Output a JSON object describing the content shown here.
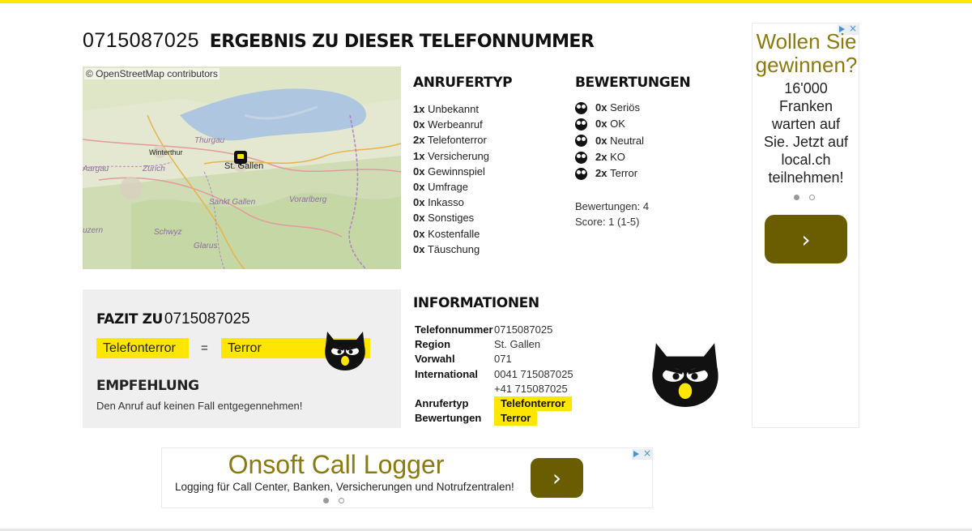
{
  "header": {
    "number": "0715087025",
    "title_suffix": "ERGEBNIS ZU DIESER TELEFONNUMMER"
  },
  "map": {
    "attribution": "© OpenStreetMap contributors",
    "center_city": "St. Gallen",
    "labels": [
      "Thurgau",
      "Winterthur",
      "Aargau",
      "Zürich",
      "Sankt Gallen",
      "Vorarlberg",
      "Schwyz",
      "Glarus",
      "uzern"
    ],
    "pin_icon": "map-marker-icon"
  },
  "anrufertyp": {
    "title": "ANRUFERTYP",
    "items": [
      {
        "count": "1x",
        "label": "Unbekannt"
      },
      {
        "count": "0x",
        "label": "Werbeanruf"
      },
      {
        "count": "2x",
        "label": "Telefonterror"
      },
      {
        "count": "1x",
        "label": "Versicherung"
      },
      {
        "count": "0x",
        "label": "Gewinnspiel"
      },
      {
        "count": "0x",
        "label": "Umfrage"
      },
      {
        "count": "0x",
        "label": "Inkasso"
      },
      {
        "count": "0x",
        "label": "Sonstiges"
      },
      {
        "count": "0x",
        "label": "Kostenfalle"
      },
      {
        "count": "0x",
        "label": "Täuschung"
      }
    ]
  },
  "bewertungen": {
    "title": "BEWERTUNGEN",
    "items": [
      {
        "count": "0x",
        "label": "Seriös",
        "icon": "owl-serioes-icon"
      },
      {
        "count": "0x",
        "label": "OK",
        "icon": "owl-ok-icon"
      },
      {
        "count": "0x",
        "label": "Neutral",
        "icon": "owl-neutral-icon"
      },
      {
        "count": "2x",
        "label": "KO",
        "icon": "owl-ko-icon"
      },
      {
        "count": "2x",
        "label": "Terror",
        "icon": "owl-terror-icon"
      }
    ],
    "total_text": "Bewertungen: 4",
    "score_text": "Score: 1 (1-5)"
  },
  "fazit": {
    "title_bold": "FAZIT ZU",
    "number": "0715087025",
    "type_tag": "Telefonterror",
    "equals": "=",
    "rating_tag": "Terror",
    "empfehlung_title": "EMPFEHLUNG",
    "empfehlung_text": "Den Anruf auf keinen Fall entgegennehmen!"
  },
  "informationen": {
    "title": "INFORMATIONEN",
    "rows": {
      "telefonnummer": {
        "key": "Telefonnummer",
        "value": "0715087025"
      },
      "region": {
        "key": "Region",
        "value": "St. Gallen"
      },
      "vorwahl": {
        "key": "Vorwahl",
        "value": "071"
      },
      "international": {
        "key": "International",
        "value1": "0041 715087025",
        "value2": "+41 715087025"
      },
      "anrufertyp": {
        "key": "Anrufertyp",
        "value": "Telefonterror"
      },
      "bewertungen": {
        "key": "Bewertungen",
        "value": "Terror"
      }
    }
  },
  "ad_right": {
    "headline": "Wollen Sie gewinnen?",
    "body": "16'000 Franken warten auf Sie. Jetzt auf local.ch teilnehmen!",
    "button_glyph": "›"
  },
  "ad_bottom": {
    "headline": "Onsoft Call Logger",
    "body": "Logging für Call Center, Banken, Versicherungen und Notrufzentralen!",
    "button_glyph": "›"
  },
  "colors": {
    "accent": "#ffe600",
    "ad_button": "#6a5c00",
    "ad_headline": "#8a7a10",
    "panel_bg": "#efefef"
  }
}
